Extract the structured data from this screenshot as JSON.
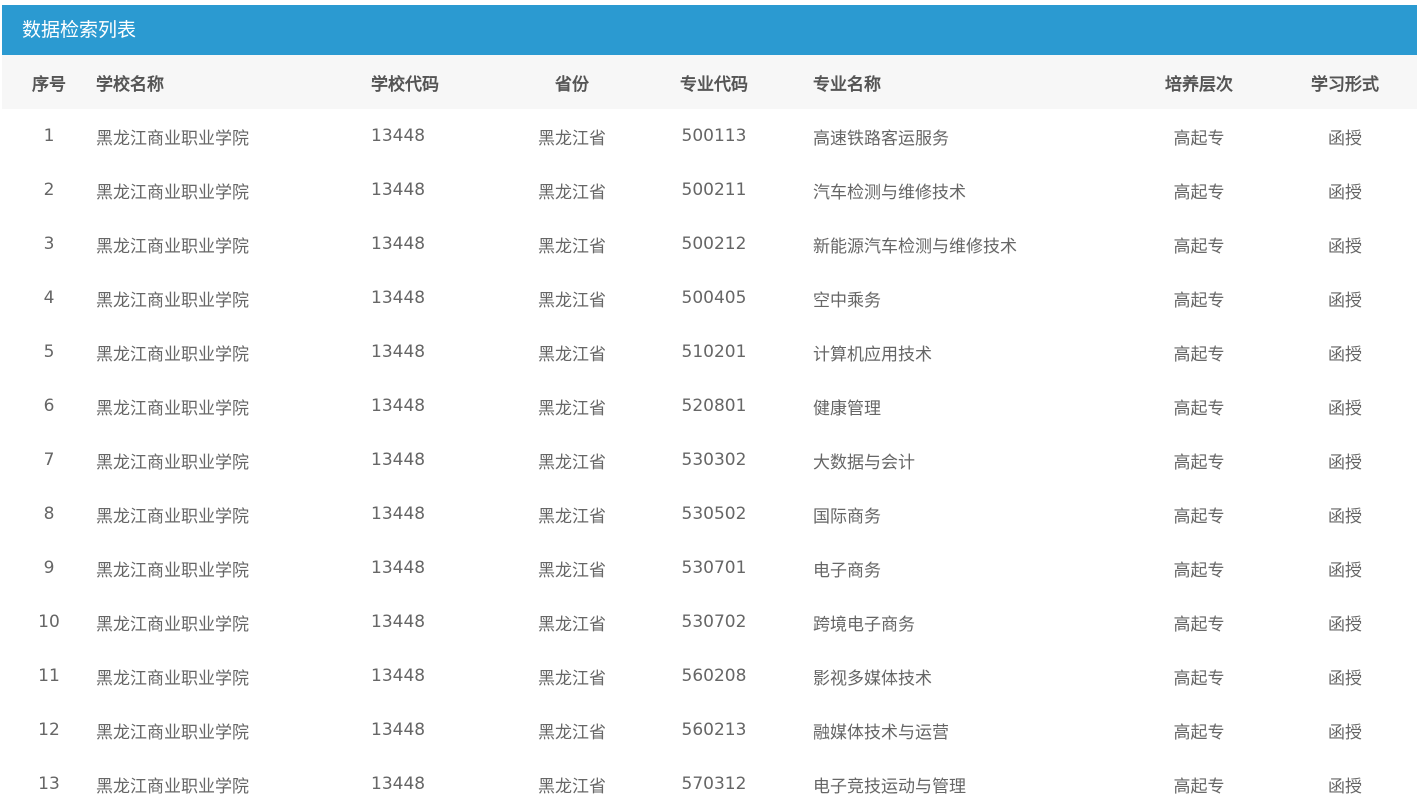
{
  "panel": {
    "title": "数据检索列表"
  },
  "table": {
    "headers": {
      "index": "序号",
      "school_name": "学校名称",
      "school_code": "学校代码",
      "province": "省份",
      "major_code": "专业代码",
      "major_name": "专业名称",
      "level": "培养层次",
      "study_form": "学习形式"
    },
    "rows": [
      {
        "index": "1",
        "school_name": "黑龙江商业职业学院",
        "school_code": "13448",
        "province": "黑龙江省",
        "major_code": "500113",
        "major_name": "高速铁路客运服务",
        "level": "高起专",
        "study_form": "函授"
      },
      {
        "index": "2",
        "school_name": "黑龙江商业职业学院",
        "school_code": "13448",
        "province": "黑龙江省",
        "major_code": "500211",
        "major_name": "汽车检测与维修技术",
        "level": "高起专",
        "study_form": "函授"
      },
      {
        "index": "3",
        "school_name": "黑龙江商业职业学院",
        "school_code": "13448",
        "province": "黑龙江省",
        "major_code": "500212",
        "major_name": "新能源汽车检测与维修技术",
        "level": "高起专",
        "study_form": "函授"
      },
      {
        "index": "4",
        "school_name": "黑龙江商业职业学院",
        "school_code": "13448",
        "province": "黑龙江省",
        "major_code": "500405",
        "major_name": "空中乘务",
        "level": "高起专",
        "study_form": "函授"
      },
      {
        "index": "5",
        "school_name": "黑龙江商业职业学院",
        "school_code": "13448",
        "province": "黑龙江省",
        "major_code": "510201",
        "major_name": "计算机应用技术",
        "level": "高起专",
        "study_form": "函授"
      },
      {
        "index": "6",
        "school_name": "黑龙江商业职业学院",
        "school_code": "13448",
        "province": "黑龙江省",
        "major_code": "520801",
        "major_name": "健康管理",
        "level": "高起专",
        "study_form": "函授"
      },
      {
        "index": "7",
        "school_name": "黑龙江商业职业学院",
        "school_code": "13448",
        "province": "黑龙江省",
        "major_code": "530302",
        "major_name": "大数据与会计",
        "level": "高起专",
        "study_form": "函授"
      },
      {
        "index": "8",
        "school_name": "黑龙江商业职业学院",
        "school_code": "13448",
        "province": "黑龙江省",
        "major_code": "530502",
        "major_name": "国际商务",
        "level": "高起专",
        "study_form": "函授"
      },
      {
        "index": "9",
        "school_name": "黑龙江商业职业学院",
        "school_code": "13448",
        "province": "黑龙江省",
        "major_code": "530701",
        "major_name": "电子商务",
        "level": "高起专",
        "study_form": "函授"
      },
      {
        "index": "10",
        "school_name": "黑龙江商业职业学院",
        "school_code": "13448",
        "province": "黑龙江省",
        "major_code": "530702",
        "major_name": "跨境电子商务",
        "level": "高起专",
        "study_form": "函授"
      },
      {
        "index": "11",
        "school_name": "黑龙江商业职业学院",
        "school_code": "13448",
        "province": "黑龙江省",
        "major_code": "560208",
        "major_name": "影视多媒体技术",
        "level": "高起专",
        "study_form": "函授"
      },
      {
        "index": "12",
        "school_name": "黑龙江商业职业学院",
        "school_code": "13448",
        "province": "黑龙江省",
        "major_code": "560213",
        "major_name": "融媒体技术与运营",
        "level": "高起专",
        "study_form": "函授"
      },
      {
        "index": "13",
        "school_name": "黑龙江商业职业学院",
        "school_code": "13448",
        "province": "黑龙江省",
        "major_code": "570312",
        "major_name": "电子竞技运动与管理",
        "level": "高起专",
        "study_form": "函授"
      }
    ]
  }
}
